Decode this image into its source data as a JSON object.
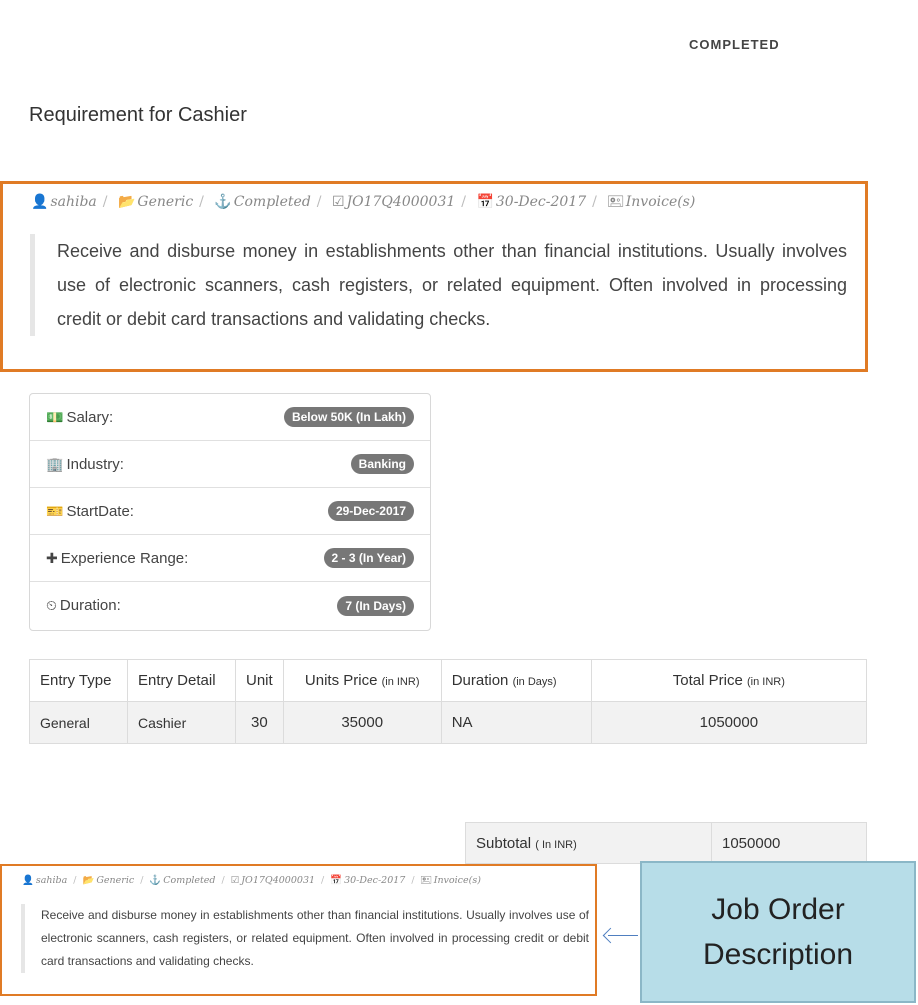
{
  "status": "COMPLETED",
  "title": "Requirement for Cashier",
  "meta": [
    {
      "icon": "user-icon",
      "glyph": "👤",
      "text": "sahiba"
    },
    {
      "icon": "folder-icon",
      "glyph": "📂",
      "text": "Generic"
    },
    {
      "icon": "anchor-icon",
      "glyph": "⚓",
      "text": "Completed"
    },
    {
      "icon": "check-square-icon",
      "glyph": "☑",
      "text": "JO17Q4000031"
    },
    {
      "icon": "calendar-icon",
      "glyph": "📅",
      "text": "30-Dec-2017"
    },
    {
      "icon": "invoice-icon",
      "glyph": "🖭",
      "text": "Invoice(s)"
    }
  ],
  "description": "Receive and disburse money in establishments other than financial institutions. Usually involves use of electronic scanners, cash registers, or related equipment. Often involved in processing credit or debit card transactions and validating checks.",
  "details": [
    {
      "icon": "money-icon",
      "glyph": "💵",
      "label": "Salary:",
      "value": "Below 50K  (In Lakh)"
    },
    {
      "icon": "building-icon",
      "glyph": "🏢",
      "label": "Industry:",
      "value": "Banking"
    },
    {
      "icon": "ticket-icon",
      "glyph": "🎫",
      "label": "StartDate:",
      "value": "29-Dec-2017"
    },
    {
      "icon": "plus-icon",
      "glyph": "✚",
      "label": "Experience Range:",
      "value": "2 - 3  (In Year)"
    },
    {
      "icon": "clock-icon",
      "glyph": "⏲",
      "label": "Duration:",
      "value": "7  (In Days)"
    }
  ],
  "entries": {
    "headers": [
      {
        "label": "Entry Type",
        "unit": ""
      },
      {
        "label": "Entry Detail",
        "unit": ""
      },
      {
        "label": "Unit",
        "unit": ""
      },
      {
        "label": "Units Price",
        "unit": "(in INR)"
      },
      {
        "label": "Duration",
        "unit": "(in Days)"
      },
      {
        "label": "Total Price",
        "unit": "(in INR)"
      }
    ],
    "rows": [
      [
        "General",
        "Cashier",
        "30",
        "35000",
        "NA",
        "1050000"
      ]
    ]
  },
  "subtotal": {
    "label": "Subtotal",
    "unit": "( In INR)",
    "value": "1050000"
  },
  "callout": {
    "line1": "Job Order",
    "line2": "Description"
  }
}
